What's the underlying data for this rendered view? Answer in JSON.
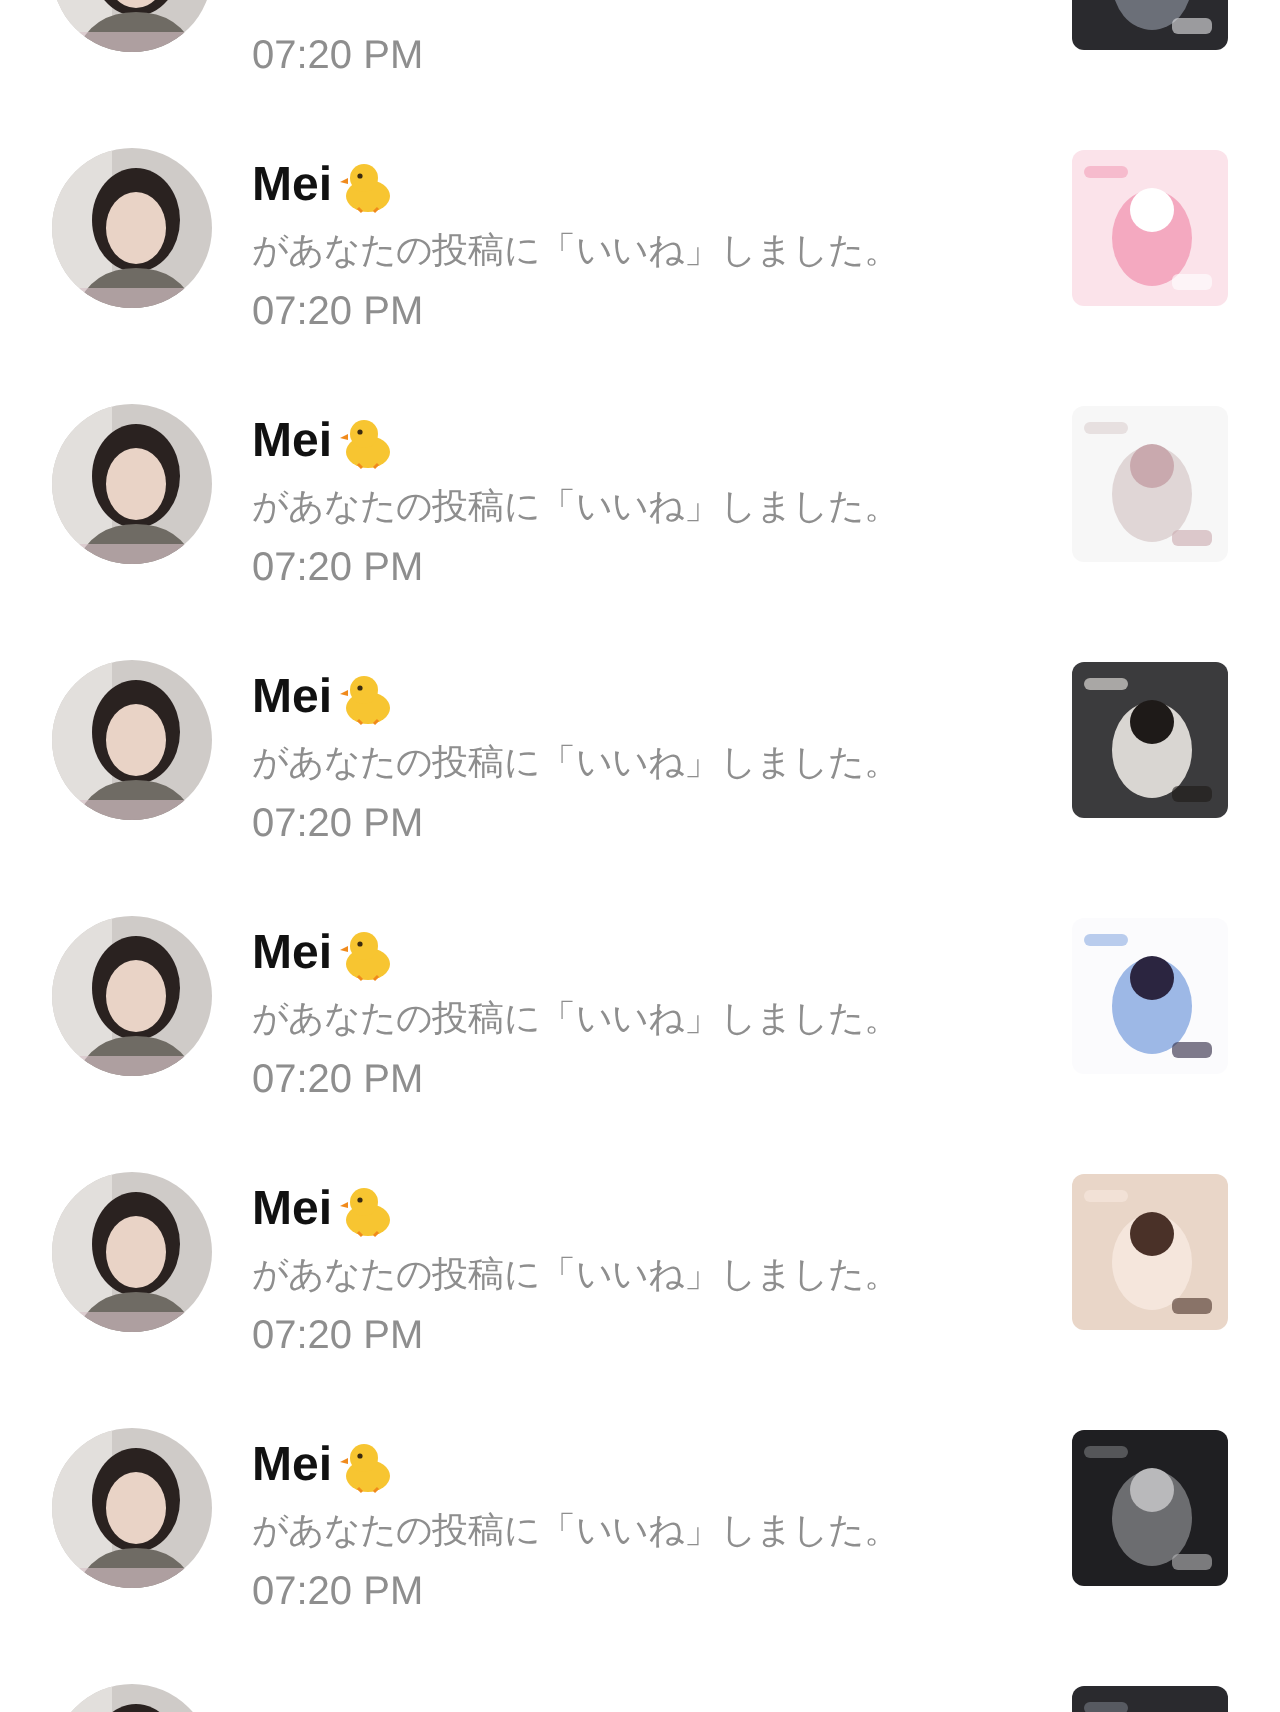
{
  "notifications": [
    {
      "time": "07:20 PM",
      "avatar": {
        "kind": "picture"
      },
      "thumbnail": {
        "kind": "picture"
      }
    },
    {
      "name": "Mei",
      "message": "があなたの投稿に「いいね」しました。",
      "time": "07:20 PM",
      "avatar": {
        "kind": "picture"
      },
      "thumbnail": {
        "kind": "picture"
      }
    },
    {
      "name": "Mei",
      "message": "があなたの投稿に「いいね」しました。",
      "time": "07:20 PM",
      "avatar": {
        "kind": "picture"
      },
      "thumbnail": {
        "kind": "picture"
      }
    },
    {
      "name": "Mei",
      "message": "があなたの投稿に「いいね」しました。",
      "time": "07:20 PM",
      "avatar": {
        "kind": "picture"
      },
      "thumbnail": {
        "kind": "picture"
      }
    },
    {
      "name": "Mei",
      "message": "があなたの投稿に「いいね」しました。",
      "time": "07:20 PM",
      "avatar": {
        "kind": "picture"
      },
      "thumbnail": {
        "kind": "picture"
      }
    },
    {
      "name": "Mei",
      "message": "があなたの投稿に「いいね」しました。",
      "time": "07:20 PM",
      "avatar": {
        "kind": "picture"
      },
      "thumbnail": {
        "kind": "picture"
      }
    },
    {
      "name": "Mei",
      "message": "があなたの投稿に「いいね」しました。",
      "time": "07:20 PM",
      "avatar": {
        "kind": "picture"
      },
      "thumbnail": {
        "kind": "picture"
      }
    },
    {
      "avatar": {
        "kind": "picture"
      },
      "thumbnail": {
        "kind": "picture"
      }
    }
  ]
}
